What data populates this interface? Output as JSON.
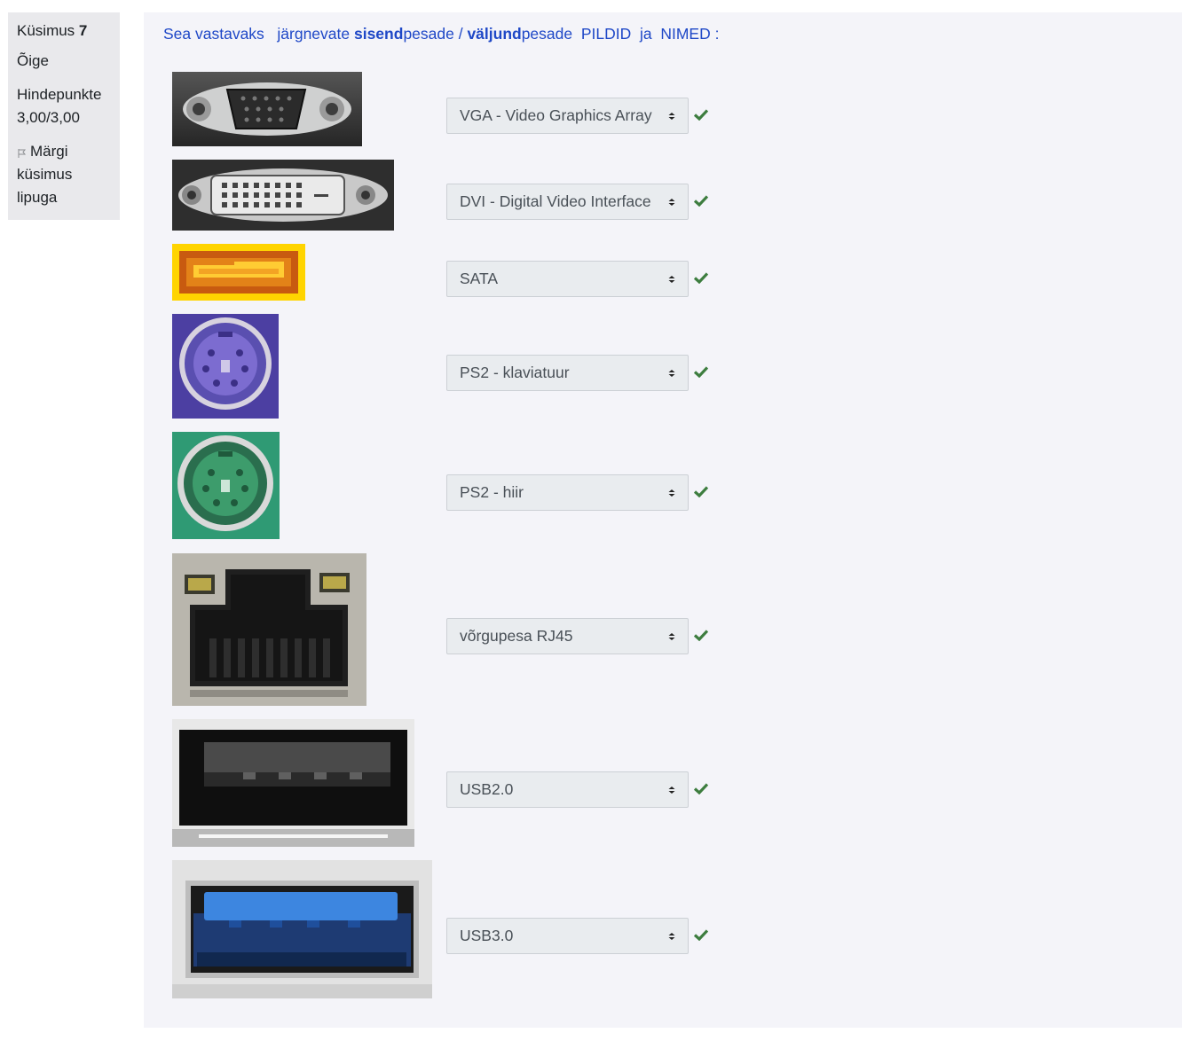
{
  "question_info": {
    "label": "Küsimus",
    "number": "7",
    "state": "Õige",
    "grade_label": "Hindepunkte",
    "grade_value": "3,00/3,00",
    "flag_label": "Märgi küsimus lipuga"
  },
  "question_text": {
    "part1": "Sea vastavaks   järgnevate ",
    "bold1": "sisend",
    "part2": "pesade / ",
    "bold2": "väljund",
    "part3": "pesade  PILDID  ja  NIMED :"
  },
  "rows": [
    {
      "image": "vga-port-photo",
      "answer": "VGA - Video Graphics Array",
      "correct": true
    },
    {
      "image": "dvi-port-photo",
      "answer": "DVI - Digital Video Interface",
      "correct": true
    },
    {
      "image": "sata-port-photo",
      "answer": "SATA",
      "correct": true
    },
    {
      "image": "ps2-keyboard-port-photo",
      "answer": "PS2 - klaviatuur",
      "correct": true
    },
    {
      "image": "ps2-mouse-port-photo",
      "answer": "PS2 - hiir",
      "correct": true
    },
    {
      "image": "rj45-port-photo",
      "answer": "võrgupesa RJ45",
      "correct": true
    },
    {
      "image": "usb2-port-photo",
      "answer": "USB2.0",
      "correct": true
    },
    {
      "image": "usb3-port-photo",
      "answer": "USB3.0",
      "correct": true
    }
  ],
  "colors": {
    "link_blue": "#1f48c7",
    "check_green": "#3d7d3f",
    "panel_bg": "#f4f4f9",
    "info_bg": "#e9e9ec",
    "select_bg": "#e9ecef"
  }
}
